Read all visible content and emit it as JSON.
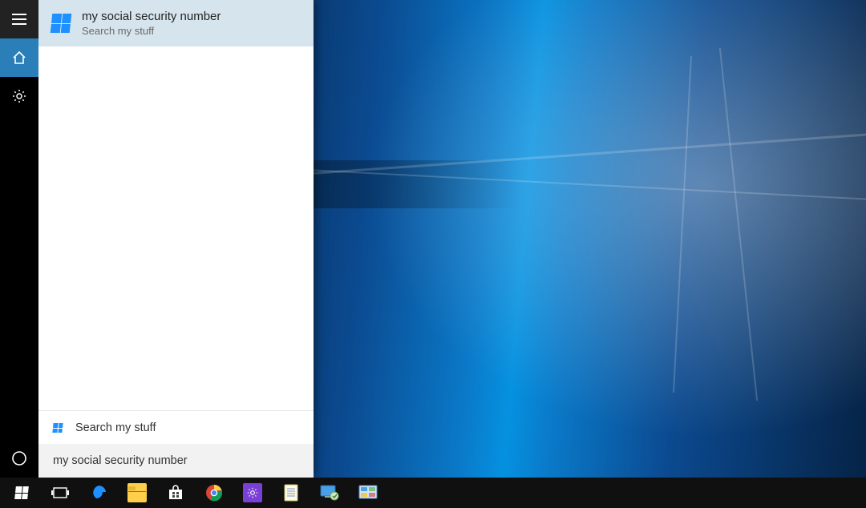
{
  "rail": {
    "items": [
      {
        "name": "hamburger",
        "active": false
      },
      {
        "name": "home",
        "active": true
      },
      {
        "name": "settings",
        "active": false
      }
    ],
    "bottom": {
      "name": "cortana"
    }
  },
  "result": {
    "title": "my social security number",
    "subtitle": "Search my stuff"
  },
  "stuff_row_label": "Search my stuff",
  "search_input_value": "my social security number",
  "taskbar": {
    "items": [
      "start",
      "task-view",
      "edge",
      "file-explorer",
      "store",
      "chrome",
      "settings-app",
      "notepad",
      "remote-desktop",
      "control-panel"
    ]
  }
}
